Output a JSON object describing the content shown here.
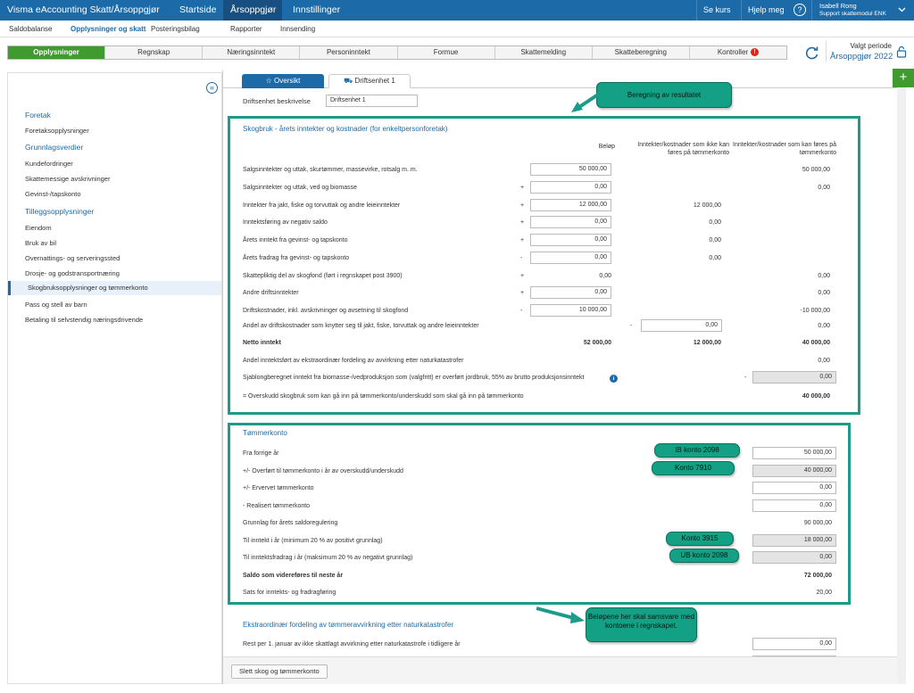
{
  "app": {
    "title": "Visma eAccounting Skatt/Årsoppgjør",
    "nav": [
      "Startside",
      "Årsoppgjør",
      "Innstillinger"
    ],
    "se_kurs": "Se kurs",
    "hjelp": "Hjelp meg",
    "help_icon": "?",
    "user_name": "Isabell Rong",
    "user_role": "Support skattemodul ENK"
  },
  "subnav": [
    "Saldobalanse",
    "Opplysninger og skatt",
    "Posteringsbilag",
    "Rapporter",
    "Innsending"
  ],
  "tabs": [
    "Opplysninger",
    "Regnskap",
    "Næringsinntekt",
    "Personinntekt",
    "Formue",
    "Skattemelding",
    "Skatteberegning",
    "Kontroller"
  ],
  "tab_badge": "!",
  "period": {
    "label": "Valgt periode",
    "value": "Årsoppgjør 2022"
  },
  "sidebar": {
    "collapse": "«",
    "groups": [
      {
        "title": "Foretak",
        "items": [
          "Foretaksopplysninger"
        ]
      },
      {
        "title": "Grunnlagsverdier",
        "items": [
          "Kundefordringer",
          "Skattemessige avskrivninger",
          "Gevinst-/tapskonto"
        ]
      },
      {
        "title": "Tilleggsopplysninger",
        "items": [
          "Eiendom",
          "Bruk av bil",
          "Overnattings- og serveringssted",
          "Drosje- og godstransportnæring",
          "Skogbruksopplysninger og tømmerkonto",
          "Pass og stell av barn",
          "Betaling til selvstendig næringsdrivende"
        ]
      }
    ]
  },
  "subtabs": [
    "Oversikt",
    "Driftsenhet 1"
  ],
  "add": "+",
  "driftsenhet": {
    "label": "Driftsenhet beskrivelse",
    "value": "Driftsenhet 1"
  },
  "callouts": {
    "resultat": "Beregning av resultatet",
    "samsvar": "Beløpene her skal samsvare med kontoene i regnskapet."
  },
  "skogbruk": {
    "title": "Skogbruk - årets inntekter og kostnader (for enkeltpersonforetak)",
    "col_belop": "Beløp",
    "col_ikke": "Inntekter/kostnader som ikke kan føres på tømmerkonto",
    "col_kan": "Inntekter/kostnader som kan føres på tømmerkonto",
    "rows": [
      {
        "label": "Salgsinntekter og uttak, skurtømmer, massevirke, rotsalg m. m.",
        "op": "",
        "belop": "50 000,00",
        "ikke": "",
        "kan": "50 000,00"
      },
      {
        "label": "Salgsinntekter og uttak, ved og biomasse",
        "op": "+",
        "belop": "0,00",
        "ikke": "",
        "kan": "0,00"
      },
      {
        "label": "Inntekter fra jakt, fiske og torvuttak og andre leieinntekter",
        "op": "+",
        "belop": "12 000,00",
        "ikke": "12 000,00",
        "kan": ""
      },
      {
        "label": "Inntektsføring av negativ saldo",
        "op": "+",
        "belop": "0,00",
        "ikke": "0,00",
        "kan": ""
      },
      {
        "label": "Årets inntekt fra gevinst- og tapskonto",
        "op": "+",
        "belop": "0,00",
        "ikke": "0,00",
        "kan": ""
      },
      {
        "label": "Årets fradrag fra gevinst- og tapskonto",
        "op": "-",
        "belop": "0,00",
        "ikke": "0,00",
        "kan": ""
      },
      {
        "label": "Skattepliktig del av skogfond (ført i regnskapet post 3900)",
        "op": "+",
        "belop": "0,00",
        "ikke": "",
        "kan": "0,00"
      },
      {
        "label": "Andre driftsinntekter",
        "op": "+",
        "belop": "0,00",
        "ikke": "",
        "kan": "0,00"
      },
      {
        "label": "Driftskostnader, inkl. avskrivninger og avsetning til skogfond",
        "op": "-",
        "belop": "10 000,00",
        "ikke": "",
        "kan": "-10 000,00"
      }
    ],
    "andel": {
      "label": "Andel av driftskostnader som knytter seg til jakt, fiske, torvuttak og andre leieinntekter",
      "op": "-",
      "ikke": "0,00",
      "kan": "0,00"
    },
    "netto": {
      "label": "Netto inntekt",
      "belop": "52 000,00",
      "ikke": "12 000,00",
      "kan": "40 000,00"
    },
    "ekstra": {
      "label": "Andel inntektsført av ekstraordinær fordeling av avvirkning etter naturkatastrofer",
      "kan": "0,00"
    },
    "sjablong": {
      "label": "Sjablongberegnet inntekt fra biomasse-/vedproduksjon som (valgfritt) er overført jordbruk, 55% av brutto produksjonsinntekt",
      "op": "-",
      "kan": "0,00"
    },
    "overskudd": {
      "label": "= Overskudd skogbruk som kan gå inn på tømmerkonto/underskudd som skal gå inn på tømmerkonto",
      "kan": "40 000,00"
    }
  },
  "tommerkonto": {
    "title": "Tømmerkonto",
    "rows": [
      {
        "label": "Fra forrige år",
        "value": "50 000,00",
        "tag": "IB konto 2098"
      },
      {
        "label": "+/- Overført til tømmerkonto i år av overskudd/underskudd",
        "value": "40 000,00",
        "tag": "Konto 7910"
      },
      {
        "label": "+/- Ervervet tømmerkonto",
        "value": "0,00",
        "tag": ""
      },
      {
        "label": "- Realisert tømmerkonto",
        "value": "0,00",
        "tag": ""
      },
      {
        "label": "Grunnlag for årets saldoregulering",
        "value": "90 000,00",
        "tag": ""
      },
      {
        "label": "Til inntekt i år (minimum 20 % av positivt grunnlag)",
        "value": "18 000,00",
        "tag": "Konto 3915"
      },
      {
        "label": "Til inntektsfradrag i år (maksimum 20 % av negativt grunnlag)",
        "value": "0,00",
        "tag": "UB konto 2098"
      },
      {
        "label": "Saldo som videreføres til neste år",
        "value": "72 000,00",
        "tag": ""
      },
      {
        "label": "Sats for inntekts- og fradragføring",
        "value": "20,00",
        "tag": ""
      }
    ]
  },
  "ekstraordinar": {
    "title": "Ekstraordinær fordeling av tømmeravvirkning etter naturkatastrofer",
    "row_label": "Rest per 1. januar av ikke skattlagt avvirkning etter naturkatastrofe i tidligere år",
    "row_value": "0,00"
  },
  "slett_button": "Slett skog og tømmerkonto",
  "colors": {
    "brand": "#1d6aa9",
    "green": "#3f9b2e",
    "teal": "#1d9a88"
  }
}
